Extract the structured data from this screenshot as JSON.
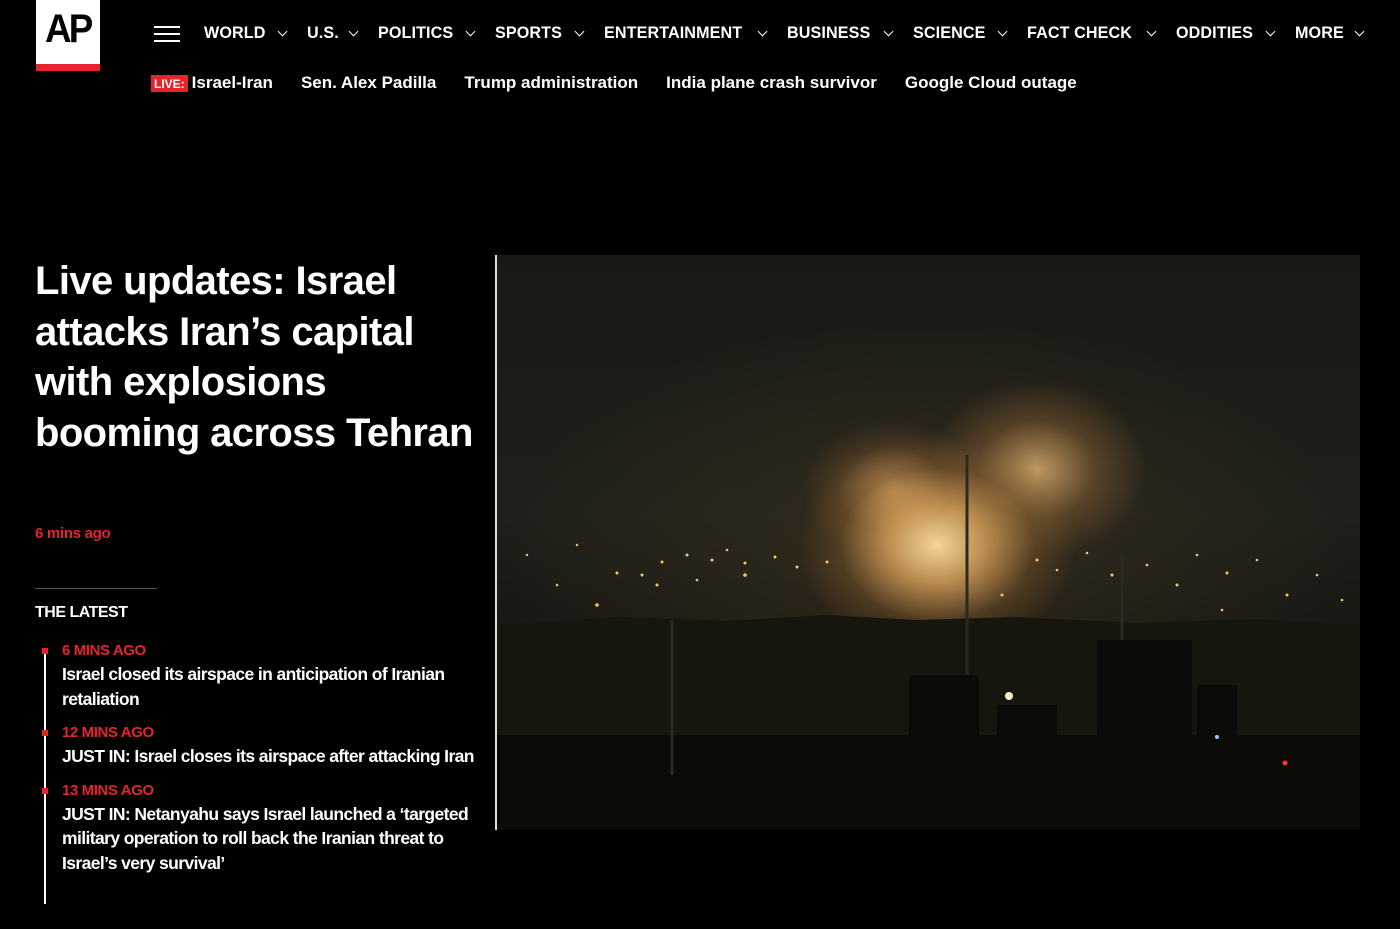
{
  "header": {
    "logo_text": "AP",
    "nav": [
      {
        "label": "WORLD"
      },
      {
        "label": "U.S."
      },
      {
        "label": "POLITICS"
      },
      {
        "label": "SPORTS"
      },
      {
        "label": "ENTERTAINMENT"
      },
      {
        "label": "BUSINESS"
      },
      {
        "label": "SCIENCE"
      },
      {
        "label": "FACT CHECK"
      },
      {
        "label": "ODDITIES"
      },
      {
        "label": "MORE"
      }
    ],
    "trending": {
      "live_badge": "LIVE:",
      "items": [
        "Israel-Iran",
        "Sen. Alex Padilla",
        "Trump administration",
        "India plane crash survivor",
        "Google Cloud outage"
      ]
    }
  },
  "main": {
    "headline": "Live updates: Israel attacks Iran’s capital with explosions booming across Tehran",
    "timestamp": "6 mins ago",
    "latest_title": "THE LATEST",
    "latest": [
      {
        "time": "6 MINS AGO",
        "text": "Israel closed its airspace in anticipation of Iranian retaliation"
      },
      {
        "time": "12 MINS AGO",
        "text": "JUST IN: Israel closes its airspace after attacking Iran"
      },
      {
        "time": "13 MINS AGO",
        "text": "JUST IN: Netanyahu says Israel launched a ‘targeted military operation to roll back the Iranian threat to Israel’s very survival’"
      }
    ]
  },
  "icons": {
    "menu": "hamburger-menu-icon",
    "dropdown": "chevron-down-icon"
  },
  "colors": {
    "accent": "#e5252b",
    "background": "#000000",
    "text": "#ffffff"
  }
}
